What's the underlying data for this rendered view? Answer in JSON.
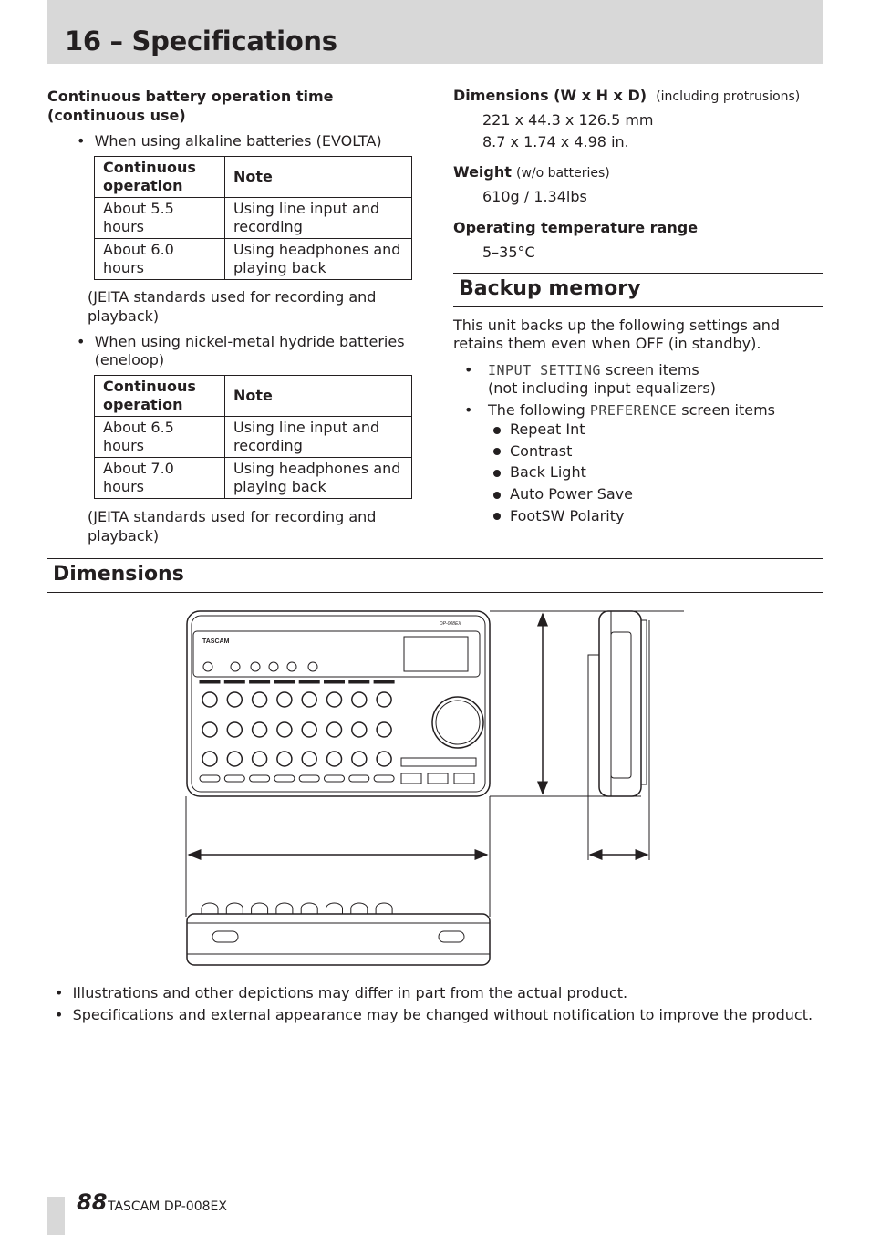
{
  "header": {
    "title": "16 – Specifications"
  },
  "battery": {
    "heading": "Continuous battery operation time (continuous use)",
    "alkaline": {
      "label": "When using alkaline batteries (EVOLTA)",
      "headers": [
        "Continuous operation",
        "Note"
      ],
      "rows": [
        [
          "About 5.5 hours",
          "Using line input and recording"
        ],
        [
          "About 6.0 hours",
          "Using headphones and playing back"
        ]
      ],
      "note": "(JEITA standards used for recording and playback)"
    },
    "nimh": {
      "label": "When using nickel-metal hydride batteries (eneloop)",
      "headers": [
        "Continuous operation",
        "Note"
      ],
      "rows": [
        [
          "About 6.5 hours",
          "Using line input and recording"
        ],
        [
          "About 7.0 hours",
          "Using headphones and playing back"
        ]
      ],
      "note": "(JEITA standards used for recording and playback)"
    }
  },
  "specs": {
    "dimensions": {
      "label": "Dimensions (W x H x D)",
      "qualifier": "(including protrusions)",
      "values": [
        "221 x 44.3 x 126.5 mm",
        "8.7 x 1.74 x 4.98 in."
      ]
    },
    "weight": {
      "label": "Weight",
      "qualifier": "(w/o batteries)",
      "value": "610g / 1.34lbs"
    },
    "temperature": {
      "label": "Operating temperature range",
      "value": "5–35°C"
    }
  },
  "backup": {
    "title": "Backup memory",
    "intro": "This unit backs up the following settings and retains them even when OFF (in standby).",
    "item1": {
      "screen": "INPUT SETTING",
      "text": " screen items",
      "sub": "(not including input equalizers)"
    },
    "item2": {
      "prefix": "The following ",
      "screen": "PREFERENCE",
      "text": " screen items"
    },
    "preferences": [
      "Repeat Int",
      "Contrast",
      "Back Light",
      "Auto Power Save",
      "FootSW Polarity"
    ]
  },
  "dimensions_section": {
    "title": "Dimensions",
    "diagram_text": [
      "TASCAM",
      "DP-008EX"
    ]
  },
  "notes": [
    "Illustrations and other depictions may differ in part from the actual product.",
    "Specifications and external appearance may be changed without notification to improve the product."
  ],
  "footer": {
    "page": "88",
    "brand": "TASCAM",
    "model": "DP-008EX"
  }
}
